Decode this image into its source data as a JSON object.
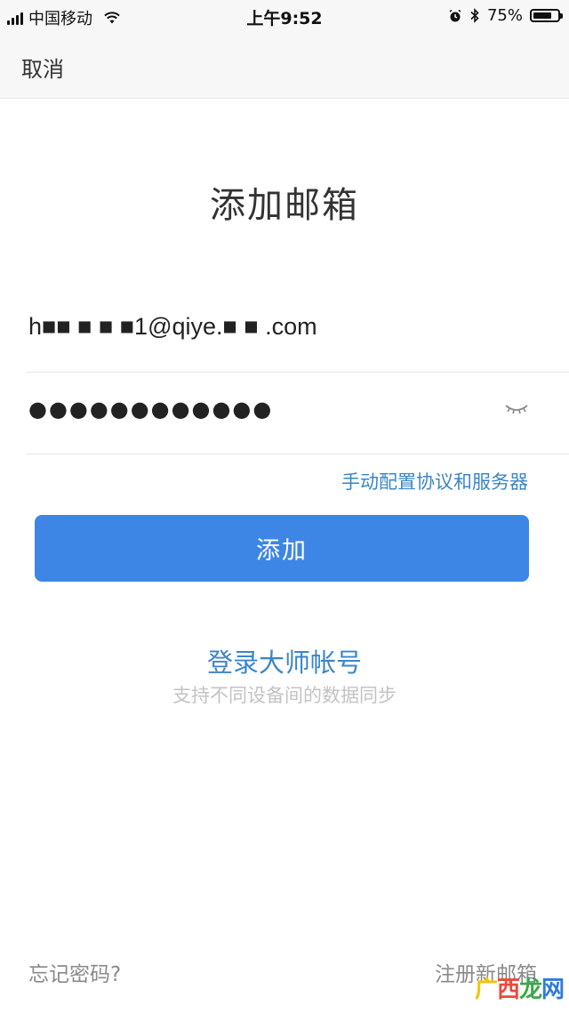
{
  "status_bar": {
    "carrier": "中国移动",
    "time": "上午9:52",
    "battery_percent": "75%",
    "battery_level": 0.75,
    "icons": [
      "signal-icon",
      "wifi-icon",
      "alarm-icon",
      "bluetooth-icon",
      "battery-icon"
    ]
  },
  "nav": {
    "cancel_label": "取消"
  },
  "title": "添加邮箱",
  "form": {
    "email_value": "h■■ ■ ■ ■1@qiye.■ ■ .com",
    "password_value": "●●●●●●●●●●●●",
    "manual_config_label": "手动配置协议和服务器",
    "add_button_label": "添加"
  },
  "master_login": {
    "link_label": "登录大师帐号",
    "hint": "支持不同设备间的数据同步"
  },
  "footer": {
    "forgot_password_label": "忘记密码?",
    "register_label": "注册新邮箱"
  },
  "watermark": {
    "part1": "广",
    "part2": "西",
    "part3": "龙",
    "part4": "网"
  },
  "colors": {
    "accent": "#3d86e6",
    "link": "#3a86c8",
    "hint": "#c3c3c3"
  }
}
